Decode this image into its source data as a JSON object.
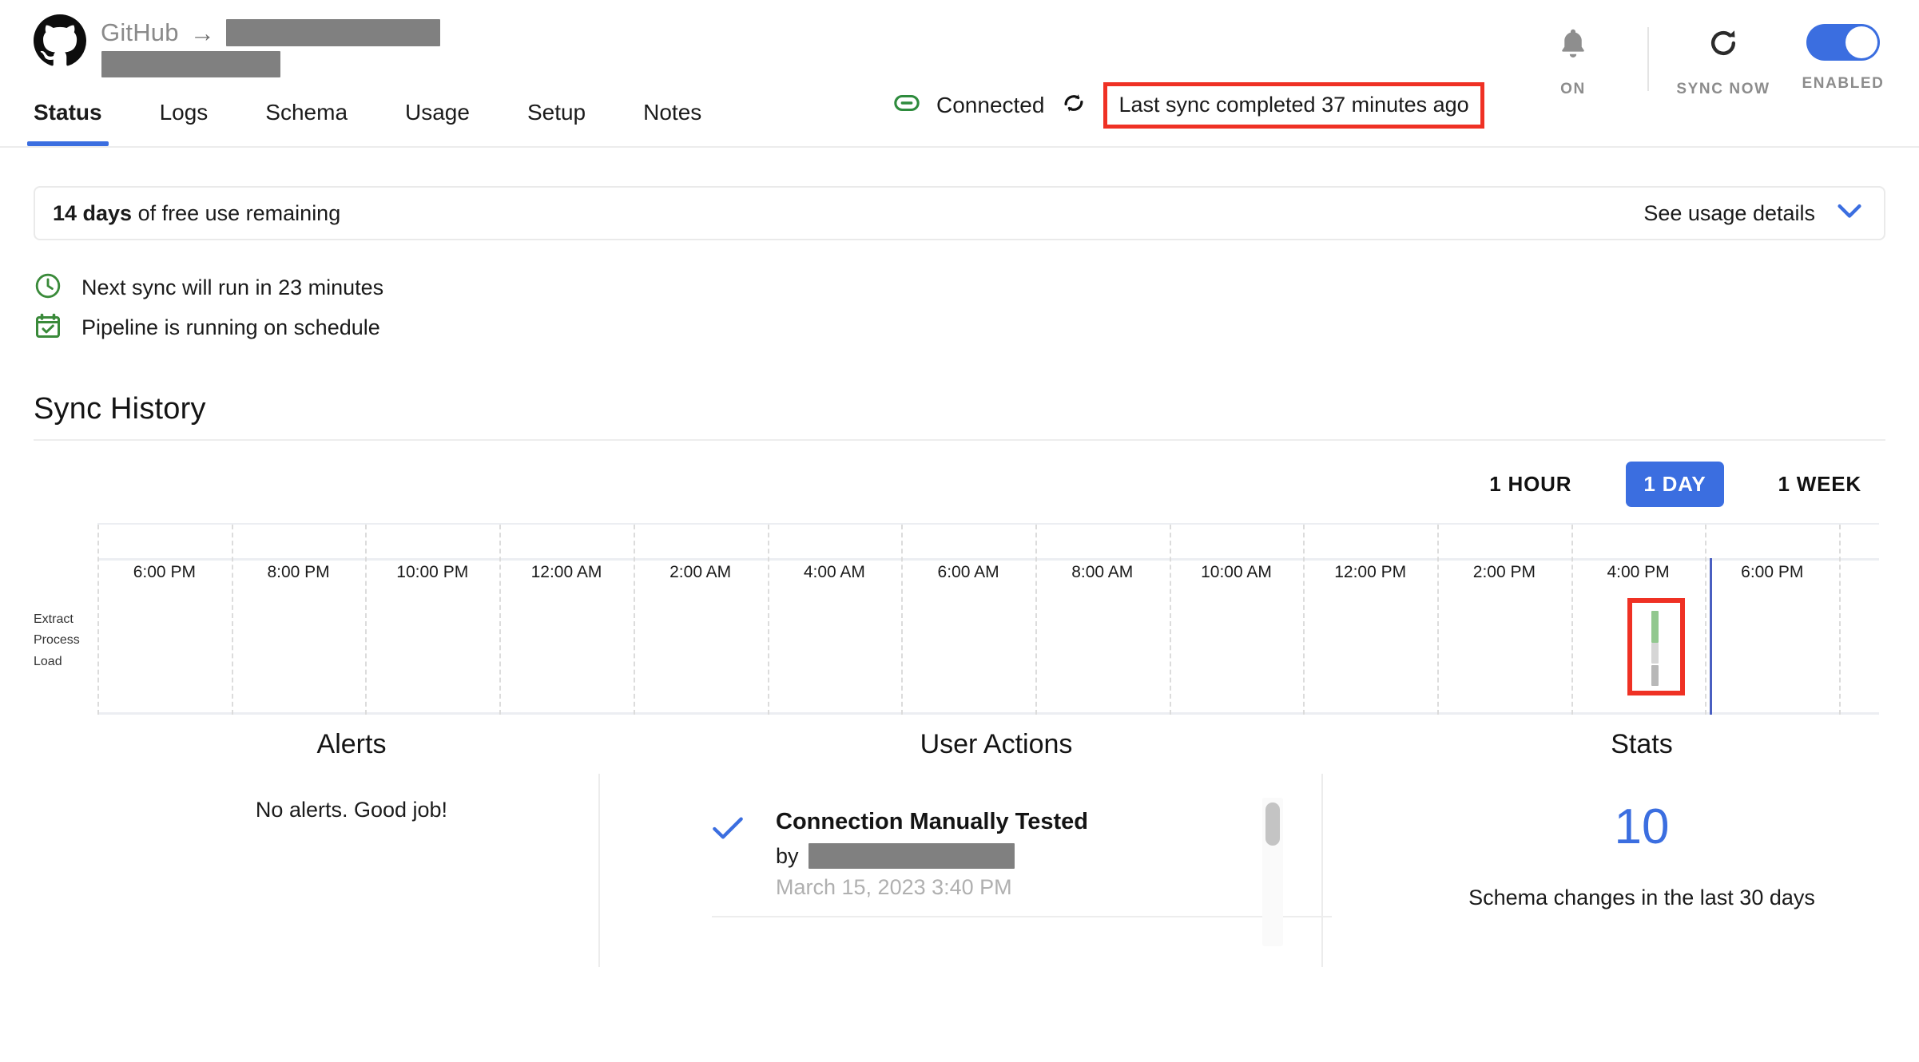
{
  "header": {
    "connector_name": "GitHub",
    "arrow": "→",
    "logo_icon": "github-logo-icon",
    "tabs": [
      {
        "label": "Status",
        "active": true
      },
      {
        "label": "Logs",
        "active": false
      },
      {
        "label": "Schema",
        "active": false
      },
      {
        "label": "Usage",
        "active": false
      },
      {
        "label": "Setup",
        "active": false
      },
      {
        "label": "Notes",
        "active": false
      }
    ],
    "connection_status": "Connected",
    "connection_icon": "link-icon",
    "sync_icon": "sync-arrows-icon",
    "last_sync_text": "Last sync completed 37 minutes ago",
    "annotation_color": "#ef3124",
    "controls": [
      {
        "label": "ON",
        "icon": "bell-icon"
      },
      {
        "label": "SYNC NOW",
        "icon": "refresh-icon"
      },
      {
        "label": "ENABLED",
        "icon": "toggle-switch-on"
      }
    ],
    "toggle_color": "#3b6ee0"
  },
  "usage_banner": {
    "highlight": "14 days",
    "rest": " of free use remaining",
    "link_label": "See usage details",
    "chevron_icon": "chevron-down-icon",
    "chevron_color": "#3b6ee0"
  },
  "status_lines": [
    {
      "icon": "clock-icon",
      "text": "Next sync will run in 23 minutes",
      "color": "#3a8a3a"
    },
    {
      "icon": "calendar-check-icon",
      "text": "Pipeline is running on schedule",
      "color": "#3a8a3a"
    }
  ],
  "sync_history": {
    "title": "Sync History",
    "ranges": [
      {
        "label": "1 HOUR",
        "active": false
      },
      {
        "label": "1 DAY",
        "active": true
      },
      {
        "label": "1 WEEK",
        "active": false
      }
    ],
    "active_range_color": "#3b6ee0"
  },
  "chart_data": {
    "type": "heatmap",
    "title": "Sync History",
    "xlabel": "",
    "ylabel": "",
    "grid": true,
    "legend_position": "none",
    "rows": [
      "Extract",
      "Process",
      "Load"
    ],
    "tick_labels": [
      "6:00 PM",
      "8:00 PM",
      "10:00 PM",
      "12:00 AM",
      "2:00 AM",
      "4:00 AM",
      "6:00 AM",
      "8:00 AM",
      "10:00 AM",
      "12:00 PM",
      "2:00 PM",
      "4:00 PM",
      "6:00 PM"
    ],
    "x_range": [
      "5:00 PM",
      "7:00 PM"
    ],
    "series": [
      {
        "name": "Extract",
        "events": [
          {
            "time": "4:00 PM",
            "color": "#92c88f"
          }
        ]
      },
      {
        "name": "Process",
        "events": [
          {
            "time": "4:00 PM",
            "color": "#d6d6d6"
          }
        ]
      },
      {
        "name": "Load",
        "events": [
          {
            "time": "4:00 PM",
            "color": "#b8b8b8"
          }
        ]
      }
    ],
    "now_marker": {
      "label": "now",
      "color": "#4a5fc1"
    },
    "annotation": {
      "target": "4:00 PM sync event",
      "color": "#ef3124"
    }
  },
  "panels": {
    "alerts": {
      "title": "Alerts",
      "message": "No alerts. Good job!"
    },
    "user_actions": {
      "title": "User Actions",
      "items": [
        {
          "icon": "checkmark-icon",
          "icon_color": "#3b6ee0",
          "title": "Connection Manually Tested",
          "by_label": "by",
          "by_user": "",
          "timestamp": "March 15, 2023 3:40 PM"
        }
      ]
    },
    "stats": {
      "title": "Stats",
      "value": "10",
      "value_color": "#3b6ee0",
      "caption": "Schema changes in the last 30 days"
    }
  }
}
